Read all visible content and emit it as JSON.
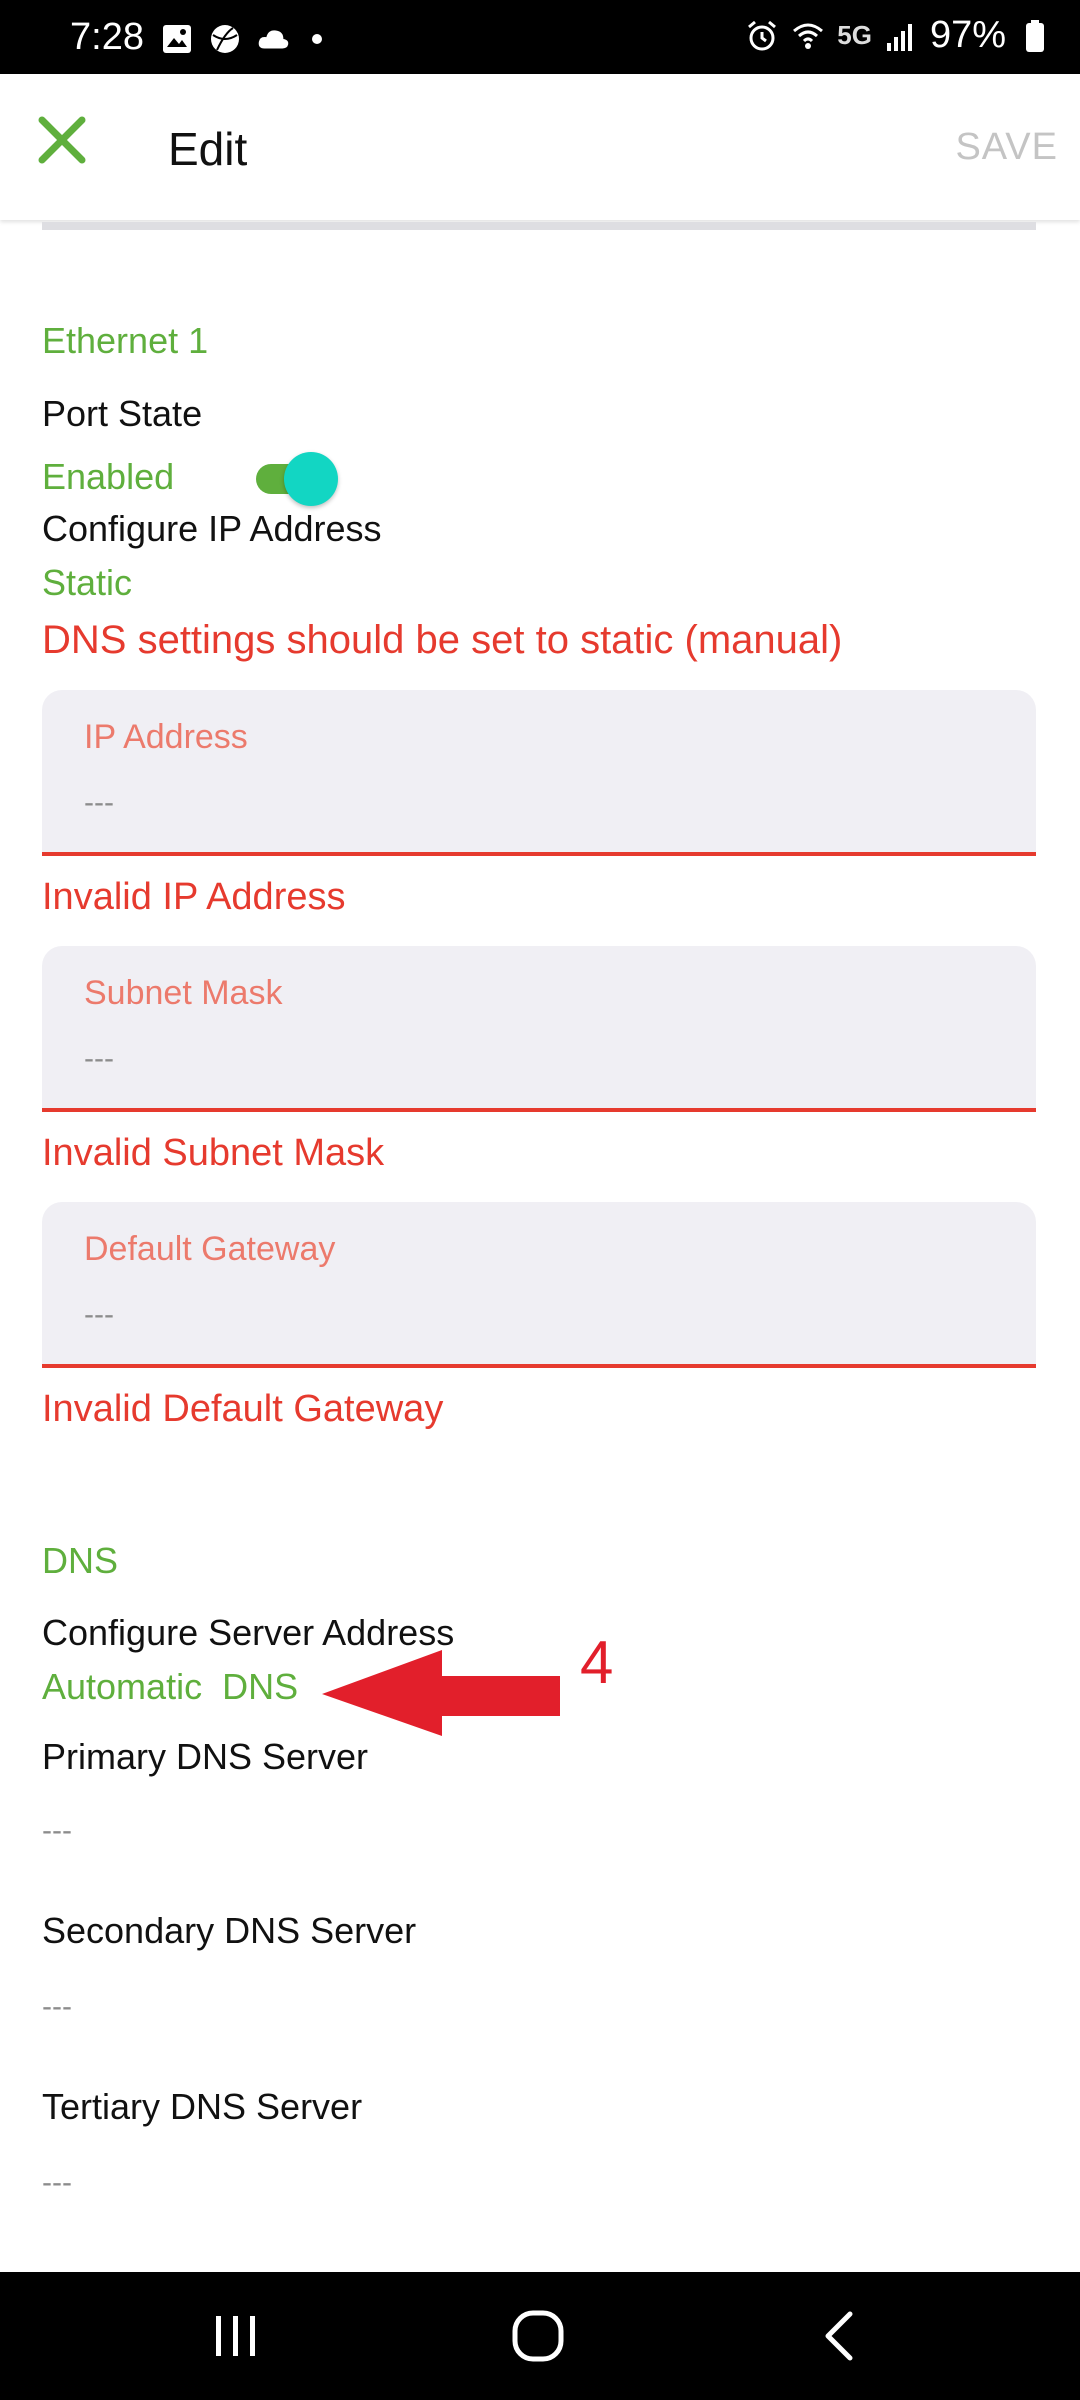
{
  "status_bar": {
    "time": "7:28",
    "network": "5G",
    "battery": "97%",
    "left_icons": [
      "image-icon",
      "sports-ball-icon",
      "cloud-icon"
    ],
    "right_icons": [
      "alarm-icon",
      "wifi-icon",
      "signal-icon",
      "battery-icon"
    ]
  },
  "app_bar": {
    "title": "Edit",
    "save_label": "SAVE",
    "close_icon": "close-icon"
  },
  "colors": {
    "accent_green": "#5faf3d",
    "error_red": "#e63a2e",
    "toggle_knob": "#12d6c3",
    "annotation_red": "#e21f2b"
  },
  "ethernet": {
    "section_title": "Ethernet 1",
    "port_state_label": "Port State",
    "port_state_value": "Enabled",
    "port_state_enabled": true,
    "configure_ip_label": "Configure IP Address",
    "configure_ip_value": "Static",
    "dns_warning": "DNS settings should be set to static (manual)",
    "fields": [
      {
        "label": "IP Address",
        "value": "---",
        "error": "Invalid IP Address"
      },
      {
        "label": "Subnet Mask",
        "value": "---",
        "error": "Invalid Subnet Mask"
      },
      {
        "label": "Default Gateway",
        "value": "---",
        "error": "Invalid Default Gateway"
      }
    ]
  },
  "dns": {
    "section_title": "DNS",
    "configure_label": "Configure Server Address",
    "configure_value": "Automatic  DNS",
    "primary_label": "Primary DNS Server",
    "primary_value": "---",
    "secondary_label": "Secondary DNS Server",
    "secondary_value": "---",
    "tertiary_label": "Tertiary DNS Server",
    "tertiary_value": "---"
  },
  "annotation": {
    "number": "4"
  },
  "nav_bar": {
    "icons": [
      "recent-apps-icon",
      "home-icon",
      "back-icon"
    ]
  }
}
